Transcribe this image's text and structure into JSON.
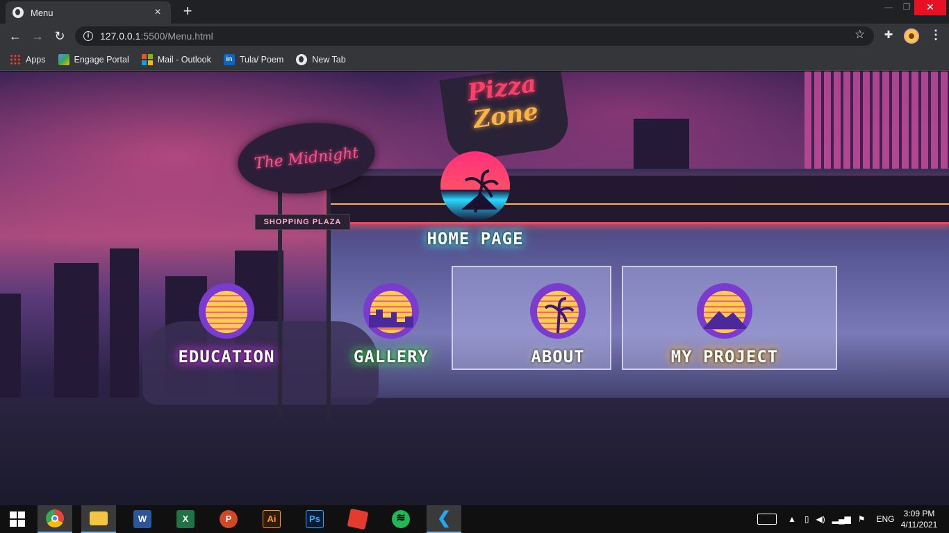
{
  "browser": {
    "tab_title": "Menu",
    "tab_close": "×",
    "new_tab": "+",
    "url_host": "127.0.0.1",
    "url_path": ":5500/Menu.html",
    "window_min": "—",
    "window_max": "❐",
    "window_close": "✕"
  },
  "bookmarks": [
    {
      "label": "Apps",
      "icon": "apps-grid-icon"
    },
    {
      "label": "Engage Portal",
      "icon": "engage-portal-icon"
    },
    {
      "label": "Mail - Outlook",
      "icon": "microsoft-icon"
    },
    {
      "label": "Tula/ Poem",
      "icon": "linkedin-icon"
    },
    {
      "label": "New Tab",
      "icon": "globe-icon"
    }
  ],
  "page": {
    "scene": {
      "sign_midnight": "The Midnight",
      "sign_plaza": "SHOPPING PLAZA",
      "sign_pizza_1": "Pizza",
      "sign_pizza_2": "Zone"
    },
    "menu": {
      "home": "HOME PAGE",
      "education": "EDUCATION",
      "gallery": "GALLERY",
      "about": "ABOUT",
      "project": "MY PROJECT"
    }
  },
  "taskbar": {
    "apps": [
      "start",
      "chrome",
      "file-explorer",
      "word",
      "excel",
      "powerpoint",
      "illustrator",
      "photoshop",
      "sketchup",
      "spotify",
      "vscode"
    ],
    "app_letters": {
      "word": "W",
      "excel": "X",
      "powerpoint": "P",
      "illustrator": "Ai",
      "photoshop": "Ps"
    },
    "language": "ENG",
    "time": "3:09 PM",
    "date": "4/11/2021"
  },
  "colors": {
    "glow_home": "#4ff3ff",
    "glow_education": "#e040ff",
    "glow_gallery": "#40ff50",
    "glow_about": "#c8c8c8",
    "glow_project": "#ffc030"
  }
}
